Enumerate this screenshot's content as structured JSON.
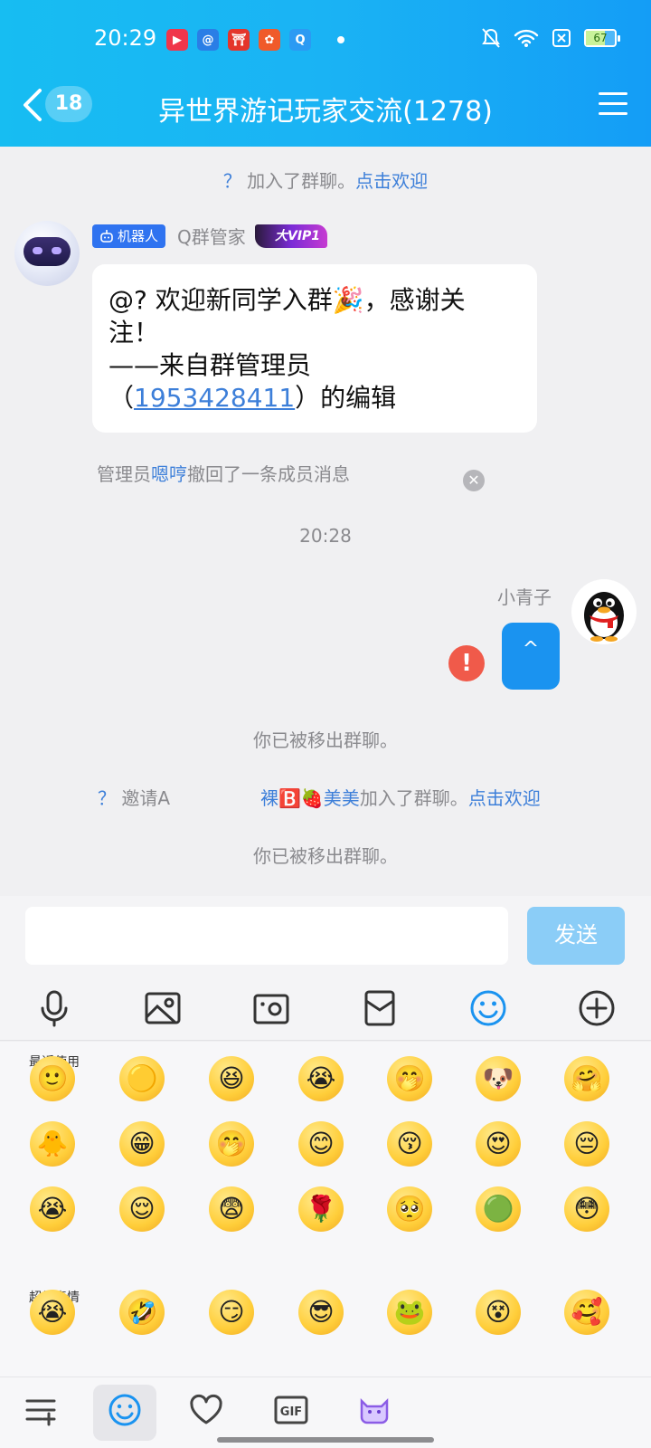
{
  "status": {
    "time": "20:29",
    "battery": "67",
    "apps": [
      {
        "name": "video-app-icon",
        "glyph": "▶",
        "color": "#f0364b"
      },
      {
        "name": "mail-app-icon",
        "glyph": "@",
        "color": "#2a7ee6"
      },
      {
        "name": "shop-app-icon",
        "glyph": "⛩",
        "color": "#e4352b"
      },
      {
        "name": "camera-app-icon",
        "glyph": "✿",
        "color": "#f05a2a"
      },
      {
        "name": "qq-app-icon",
        "glyph": "Q",
        "color": "#2b9af3"
      }
    ]
  },
  "header": {
    "unread": "18",
    "title": "异世界游记玩家交流(1278)"
  },
  "chat": {
    "join1": {
      "q": "？",
      "text": "加入了群聊。",
      "action": "点击欢迎"
    },
    "bot": {
      "tag": "机器人",
      "name": "Q群管家",
      "vip": "大VIP1",
      "line1": "@?  欢迎新同学入群🎉，感谢关",
      "line2": "注！",
      "line3": "——来自群管理员",
      "line4_pre": "（",
      "line4_num": "1953428411",
      "line4_post": "）的编辑"
    },
    "recall": {
      "pre": "管理员",
      "name": "嗯哼",
      "post": "撤回了一条成员消息"
    },
    "time": "20:28",
    "me": {
      "name": "小青子",
      "msg": "^"
    },
    "removed1": "你已被移出群聊。",
    "invite": {
      "q": "？",
      "text": "邀请A",
      "names": "裸🅱️🍓美美",
      "post": "加入了群聊。",
      "action": "点击欢迎"
    },
    "removed2": "你已被移出群聊。"
  },
  "input": {
    "placeholder": "",
    "send": "发送"
  },
  "emoji": {
    "recent_label": "最近使用",
    "super_label": "超级表情",
    "recent": [
      "🙂",
      "🟡",
      "😆",
      "😭",
      "🤭",
      "🐶",
      "🤗",
      "🐥",
      "😁",
      "🤭",
      "😊",
      "😚",
      "😍",
      "😔",
      "😭",
      "😌",
      "😨",
      "🌹",
      "🥺",
      "🟢",
      "😳"
    ],
    "super": [
      "😭",
      "🤣",
      "😏",
      "😎",
      "🐸",
      "😵",
      "🥰"
    ]
  },
  "colors": {
    "accent": "#1a93f0",
    "header": "#17bdf2",
    "link": "#3d7fd9",
    "error": "#f05a4a"
  }
}
